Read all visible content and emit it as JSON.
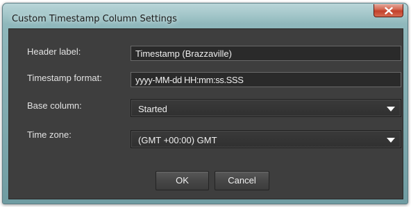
{
  "window": {
    "title": "Custom Timestamp Column Settings",
    "close_icon": "close-x-icon"
  },
  "form": {
    "header_label": {
      "label": "Header label:",
      "value": "Timestamp (Brazzaville)"
    },
    "timestamp_format": {
      "label": "Timestamp format:",
      "value": "yyyy-MM-dd HH:mm:ss.SSS"
    },
    "base_column": {
      "label": "Base column:",
      "value": "Started",
      "icon": "dropdown-arrow-icon"
    },
    "time_zone": {
      "label": "Time zone:",
      "value": "(GMT +00:00) GMT",
      "icon": "dropdown-arrow-icon"
    }
  },
  "buttons": {
    "ok": "OK",
    "cancel": "Cancel"
  },
  "colors": {
    "panel_bg": "#3e3e3e",
    "field_bg": "#2a2a2a",
    "text": "#e2e2e2",
    "close_red": "#c2412b"
  }
}
